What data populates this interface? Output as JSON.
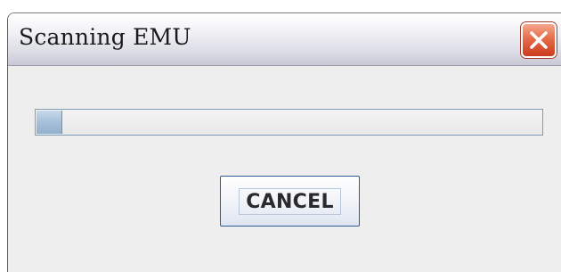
{
  "window": {
    "title": "Scanning EMU",
    "close_icon": "close-icon"
  },
  "progress": {
    "value_percent": 5
  },
  "buttons": {
    "cancel_label": "CANCEL"
  },
  "colors": {
    "progress_fill": "#a6bfd9",
    "progress_border": "#7f9db9",
    "close_button": "#e56c4a",
    "button_border": "#2e5b93"
  }
}
